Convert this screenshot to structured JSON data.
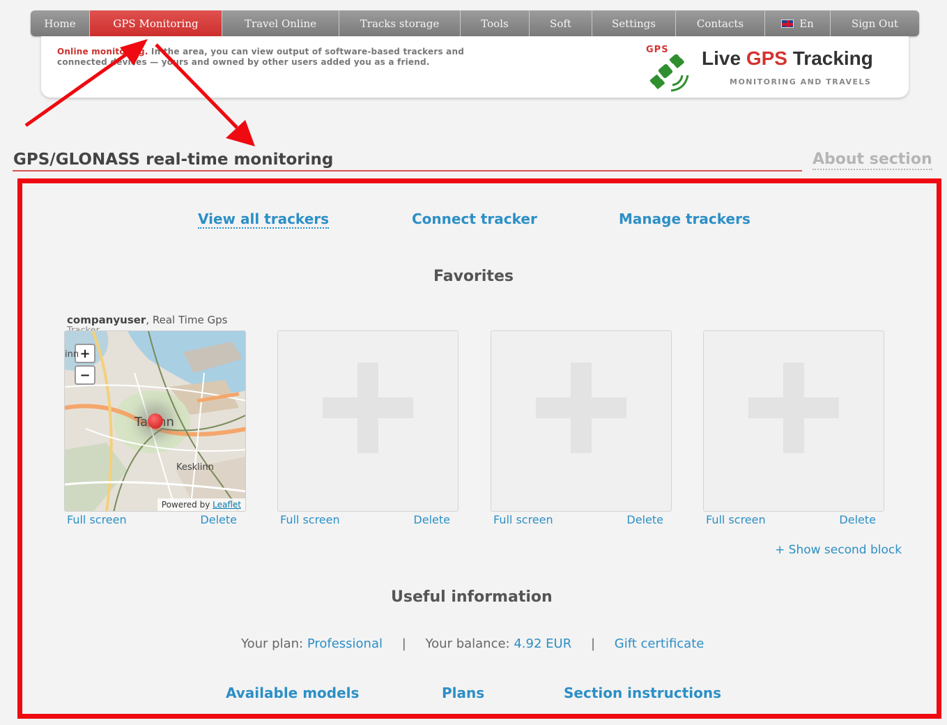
{
  "nav": {
    "items": [
      {
        "label": "Home",
        "active": false
      },
      {
        "label": "GPS Monitoring",
        "active": true
      },
      {
        "label": "Travel Online",
        "active": false
      },
      {
        "label": "Tracks storage",
        "active": false
      },
      {
        "label": "Tools",
        "active": false
      },
      {
        "label": "Soft",
        "active": false
      },
      {
        "label": "Settings",
        "active": false
      },
      {
        "label": "Contacts",
        "active": false
      },
      {
        "label": "En",
        "active": false,
        "icon": "uk-flag-icon"
      },
      {
        "label": "Sign Out",
        "active": false
      }
    ]
  },
  "header": {
    "intro_highlight": "Online monitoring.",
    "intro_text": " In the area, you can view output of software-based trackers and connected devices — yours and owned by other users added you as a friend.",
    "logo_badge": "GPS",
    "logo_title_before": "Live ",
    "logo_title_accent": "GPS",
    "logo_title_after": " Tracking",
    "logo_subtitle": "MONITORING AND TRAVELS"
  },
  "page": {
    "title": "GPS/GLONASS real-time monitoring",
    "about_link": "About section"
  },
  "top_links": {
    "view_all": "View all trackers",
    "connect": "Connect tracker",
    "manage": "Manage trackers"
  },
  "favorites": {
    "heading": "Favorites",
    "caption_user": "companyuser",
    "caption_rest": ", Real Time Gps",
    "caption_line2": "Tracker",
    "map": {
      "city_label": "Tallinn",
      "district_label": "Kesklinn",
      "edge_label": "inn",
      "zoom_in": "+",
      "zoom_out": "−",
      "attribution_prefix": "Powered by ",
      "attribution_link": "Leaflet"
    },
    "full_screen_label": "Full screen",
    "delete_label": "Delete",
    "show_second_block": "+ Show second block"
  },
  "useful": {
    "heading": "Useful information",
    "plan_label": "Your plan: ",
    "plan_value": "Professional",
    "separator": "|",
    "balance_label": "Your balance: ",
    "balance_value": "4.92 EUR",
    "gift": "Gift certificate"
  },
  "bottom_links": {
    "models": "Available models",
    "plans": "Plans",
    "instructions": "Section instructions"
  },
  "colors": {
    "accent_red": "#d43431",
    "link_blue": "#2c8fc6",
    "highlight_frame": "#ee0a10",
    "nav_gray": "#8a8a8a"
  }
}
